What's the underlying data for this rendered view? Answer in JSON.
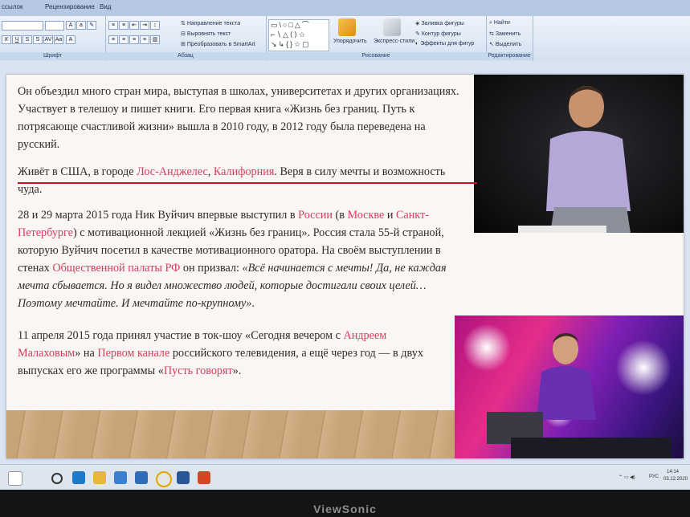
{
  "ribbon": {
    "tabs": [
      "ссылок",
      "Рецензирование",
      "Вид"
    ],
    "groups": {
      "font": "Шрифт",
      "paragraph": "Абзац",
      "drawing": "Рисование",
      "editing": "Редактирование"
    },
    "paragraph_buttons": {
      "text_direction": "Направление текста",
      "align_text": "Выровнять текст",
      "smartart": "Преобразовать в SmartArt"
    },
    "drawing_buttons": {
      "arrange": "Упорядочить",
      "quick_styles": "Экспресс-стили",
      "shape_fill": "Заливка фигуры",
      "shape_outline": "Контур фигуры",
      "shape_effects": "Эффекты для фигур"
    },
    "editing_buttons": {
      "find": "Найти",
      "replace": "Заменить",
      "select": "Выделить"
    }
  },
  "slide": {
    "p1": "Он объездил много стран мира, выступая в школах, университетах и других организациях. Участвует в телешоу и пишет книги. Его первая книга «Жизнь без границ. Путь к потрясающе счастливой жизни» вышла в 2010 году, в 2012 году была переведена на русский.",
    "p2": {
      "t1": "Живёт в США, в городе ",
      "link1": "Лос-Анджелес",
      "t2": ", ",
      "link2": "Калифорния",
      "t3": ". Веря в силу мечты и возможность чуда."
    },
    "p3": {
      "t1": "28 и 29 марта 2015 года Ник Вуйчич впервые выступил в ",
      "link1": "России",
      "t2": " (в ",
      "link2": "Москве",
      "t3": " и ",
      "link3": "Санкт-Петербурге",
      "t4": ") с мотивационной лекцией «Жизнь без границ». Россия стала 55-й страной, которую Вуйчич посетил в качестве мотивационного оратора. На своём выступлении в стенах ",
      "link4": "Общественной палаты РФ",
      "t5": " он призвал: ",
      "quote": "«Всё начинается с мечты! Да, не каждая мечта сбывается. Но я видел множество людей, которые достигали своих целей… Поэтому мечтайте. И мечтайте по-крупному»",
      "t6": "."
    },
    "p4": {
      "t1": "11 апреля 2015 года принял участие в ток-шоу «Сегодня вечером с ",
      "link1": "Андреем Малаховым",
      "t2": "» на ",
      "link2": "Первом канале",
      "t3": " российского телевидения, а ещё через год — в двух выпусках его же программы «",
      "link3": "Пусть говорят",
      "t4": "»."
    }
  },
  "taskbar": {
    "lang": "РУС",
    "time": "14:14",
    "date": "03.12.2020"
  },
  "monitor": {
    "brand": "ViewSonic"
  },
  "colors": {
    "link": "#d63d5c",
    "underline": "#c8102e",
    "ribbon": "#d4e1f1"
  }
}
